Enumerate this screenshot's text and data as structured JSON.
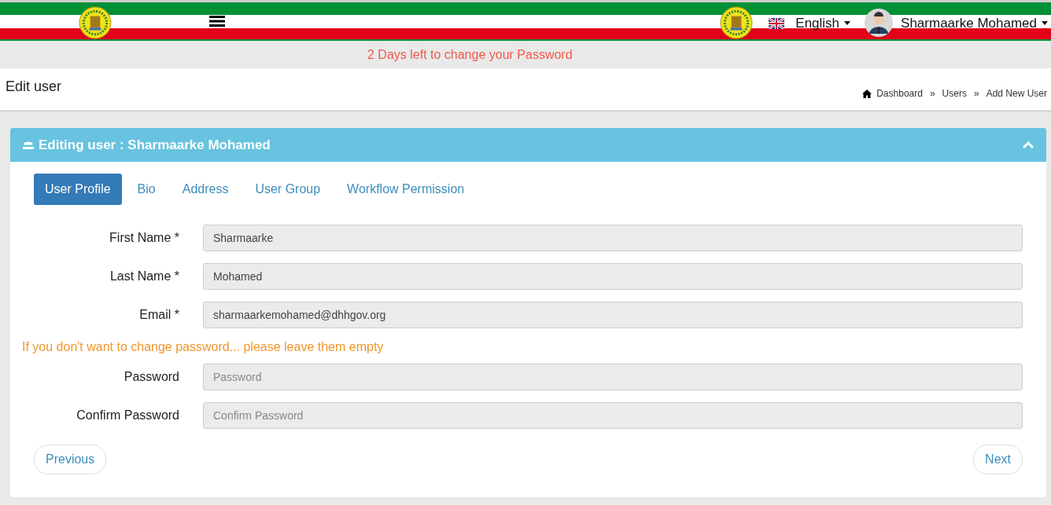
{
  "topbar": {
    "language": "English",
    "user_name": "Sharmaarke Mohamed"
  },
  "password_notice": "2 Days left to change your Password",
  "page": {
    "title": "Edit user",
    "breadcrumb": [
      {
        "label": "Dashboard"
      },
      {
        "label": "Users",
        "separator": "»"
      },
      {
        "label": "Add New User",
        "separator": "»"
      }
    ]
  },
  "card": {
    "title_prefix": "Editing user :",
    "title_name": "Sharmaarke Mohamed",
    "expanded": true
  },
  "tabs": [
    {
      "label": "User Profile",
      "selected": true
    },
    {
      "label": "Bio",
      "selected": false
    },
    {
      "label": "Address",
      "selected": false
    },
    {
      "label": "User Group",
      "selected": false
    },
    {
      "label": "Workflow Permission",
      "selected": false
    }
  ],
  "fields": [
    {
      "label": "First Name *",
      "value": "Sharmaarke"
    },
    {
      "label": "Last Name *",
      "value": "Mohamed"
    },
    {
      "label": "Email *",
      "value": "sharmaarkemohamed@dhhgov.org"
    }
  ],
  "password_hint": "If you don't want to change password... please leave them empty",
  "password_fields": [
    {
      "label": "Password",
      "placeholder": "Password"
    },
    {
      "label": "Confirm Password",
      "placeholder": "Confirm Password"
    }
  ],
  "buttons": {
    "previous": "Previous",
    "next": "Next"
  }
}
